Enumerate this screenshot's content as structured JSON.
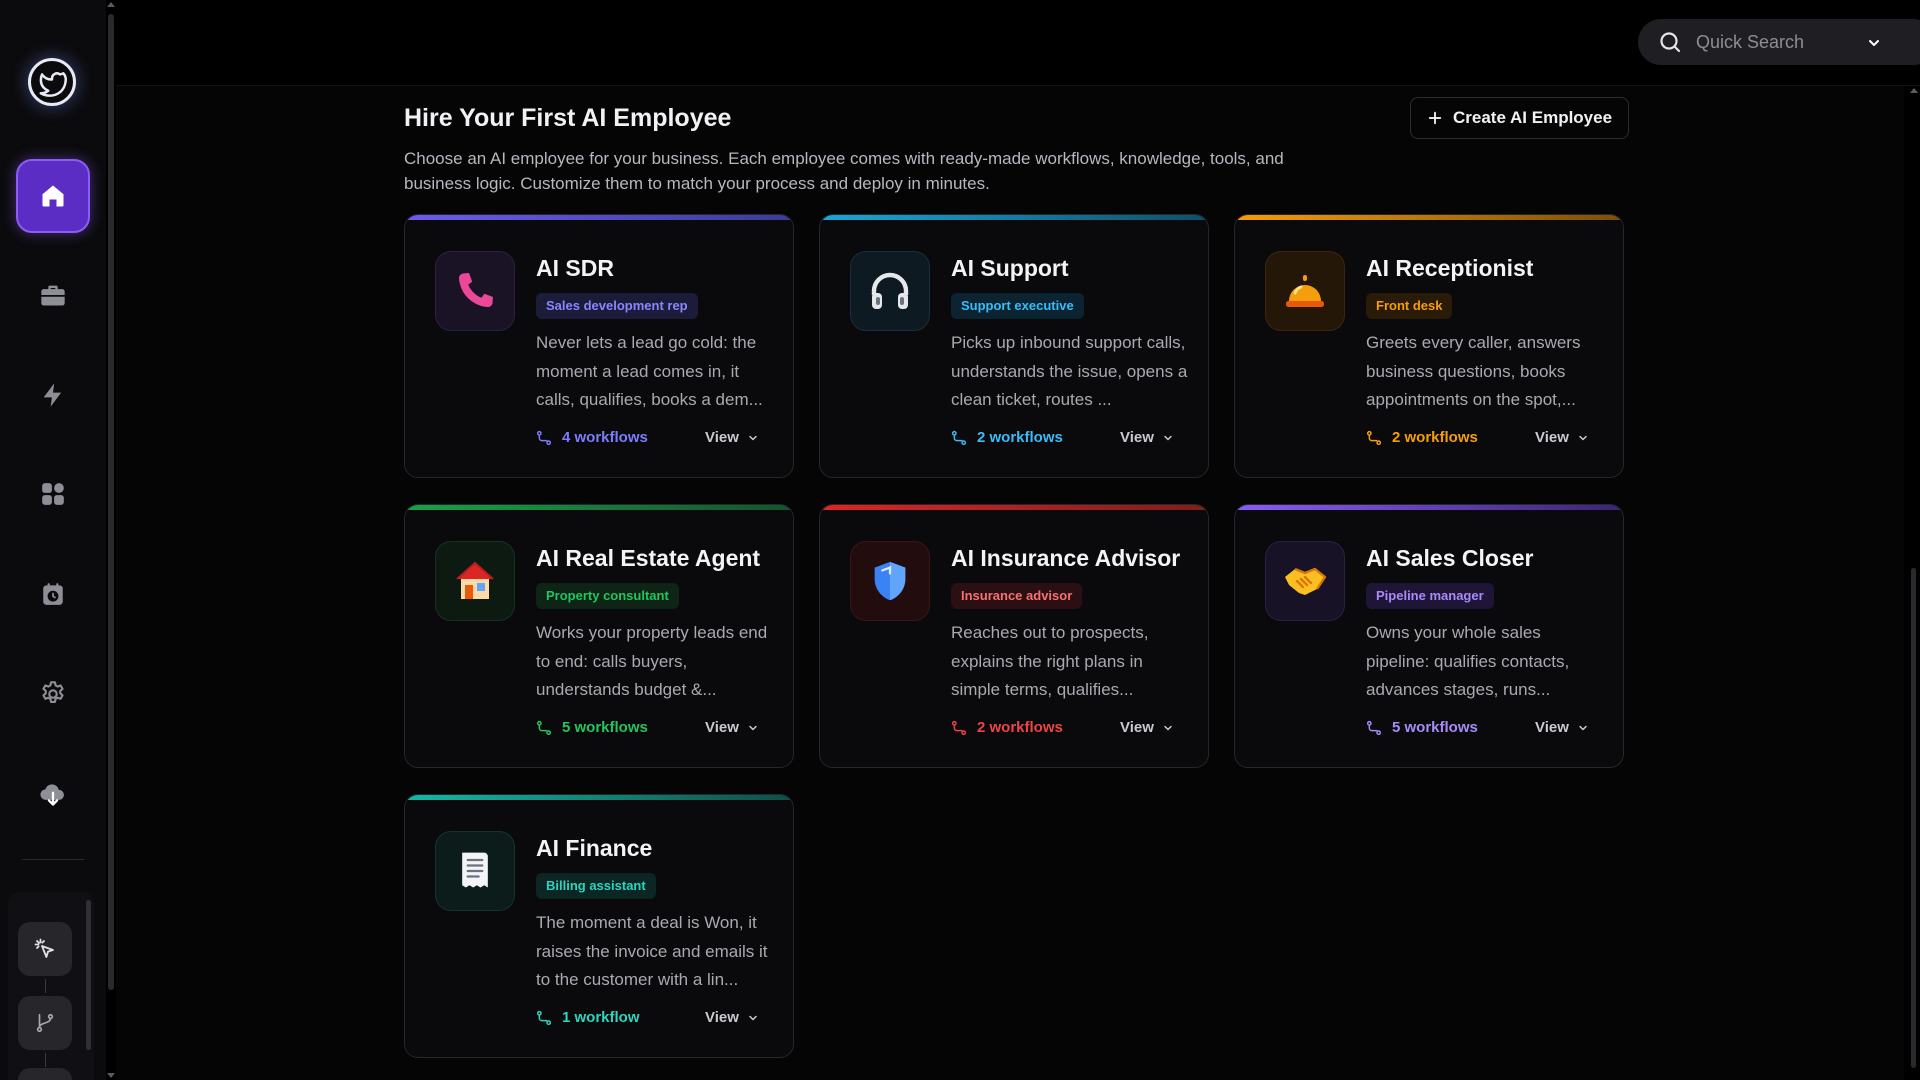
{
  "search": {
    "placeholder": "Quick Search"
  },
  "page": {
    "title": "Hire Your First AI Employee",
    "description": "Choose an AI employee for your business. Each employee comes with ready-made workflows, knowledge, tools, and business logic. Customize them to match your process and deploy in minutes.",
    "create_button": "Create AI Employee"
  },
  "sidebar": {
    "items": [
      {
        "name": "home",
        "icon": "home-icon",
        "active": true
      },
      {
        "name": "briefcase",
        "icon": "briefcase-icon",
        "active": false
      },
      {
        "name": "automations",
        "icon": "lightning-icon",
        "active": false
      },
      {
        "name": "apps",
        "icon": "grid-icon",
        "active": false
      },
      {
        "name": "schedule",
        "icon": "clock-calendar-icon",
        "active": false
      },
      {
        "name": "settings",
        "icon": "gear-icon",
        "active": false
      },
      {
        "name": "download",
        "icon": "cloud-download-icon",
        "active": false
      }
    ],
    "tools": [
      {
        "name": "click-tool",
        "icon": "cursor-click-icon"
      },
      {
        "name": "branch-tool",
        "icon": "git-branch-icon"
      }
    ]
  },
  "cards": [
    {
      "title": "AI SDR",
      "badge": "Sales development rep",
      "description": "Never lets a lead go cold: the moment a lead comes in, it calls, qualifies, books a dem...",
      "workflows": "4 workflows",
      "view": "View",
      "accent": "#7c6cf5",
      "icon": "phone-icon"
    },
    {
      "title": "AI Support",
      "badge": "Support executive",
      "description": "Picks up inbound support calls, understands the issue, opens a clean ticket, routes ...",
      "workflows": "2 workflows",
      "view": "View",
      "accent": "#38bdf8",
      "icon": "headphones-icon"
    },
    {
      "title": "AI Receptionist",
      "badge": "Front desk",
      "description": "Greets every caller, answers business questions, books appointments on the spot,...",
      "workflows": "2 workflows",
      "view": "View",
      "accent": "#f59e0b",
      "icon": "bell-icon"
    },
    {
      "title": "AI Real Estate Agent",
      "badge": "Property consultant",
      "description": "Works your property leads end to end: calls buyers, understands budget &...",
      "workflows": "5 workflows",
      "view": "View",
      "accent": "#22c55e",
      "icon": "house-icon"
    },
    {
      "title": "AI Insurance Advisor",
      "badge": "Insurance advisor",
      "description": "Reaches out to prospects, explains the right plans in simple terms, qualifies...",
      "workflows": "2 workflows",
      "view": "View",
      "accent": "#ef4444",
      "icon": "shield-icon"
    },
    {
      "title": "AI Sales Closer",
      "badge": "Pipeline manager",
      "description": "Owns your whole sales pipeline: qualifies contacts, advances stages, runs...",
      "workflows": "5 workflows",
      "view": "View",
      "accent": "#8b5cf6",
      "icon": "handshake-icon"
    },
    {
      "title": "AI Finance",
      "badge": "Billing assistant",
      "description": "The moment a deal is Won, it raises the invoice and emails it to the customer with a lin...",
      "workflows": "1 workflow",
      "view": "View",
      "accent": "#14b8a6",
      "icon": "receipt-icon"
    }
  ]
}
